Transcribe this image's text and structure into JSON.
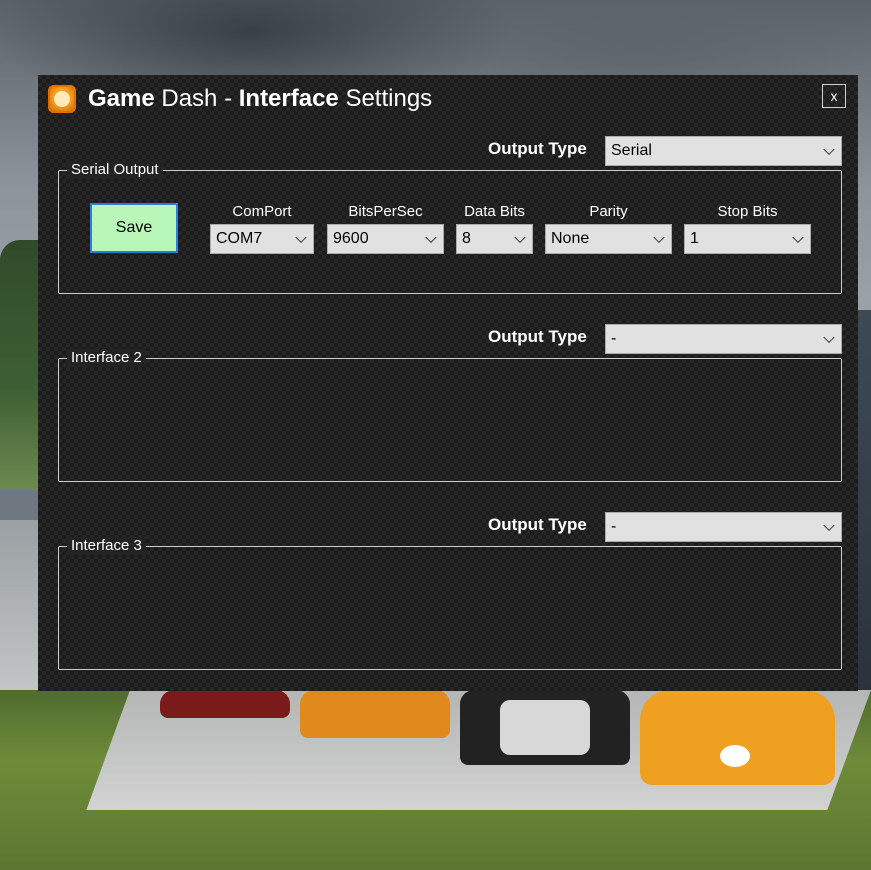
{
  "window": {
    "title_parts": [
      "Game",
      " Dash - ",
      "Interface",
      " Settings"
    ],
    "close_label": "x"
  },
  "interfaces": [
    {
      "output_type_label": "Output Type",
      "output_type_value": "Serial",
      "group_label": "Serial Output",
      "save_label": "Save",
      "fields": [
        {
          "label": "ComPort",
          "value": "COM7"
        },
        {
          "label": "BitsPerSec",
          "value": "9600"
        },
        {
          "label": "Data Bits",
          "value": "8"
        },
        {
          "label": "Parity",
          "value": "None"
        },
        {
          "label": "Stop Bits",
          "value": "1"
        }
      ]
    },
    {
      "output_type_label": "Output Type",
      "output_type_value": "-",
      "group_label": "Interface 2"
    },
    {
      "output_type_label": "Output Type",
      "output_type_value": "-",
      "group_label": "Interface 3"
    }
  ],
  "icons": {
    "app": "game-dash-logo-icon",
    "close": "close-icon",
    "dropdown": "chevron-down-icon"
  }
}
